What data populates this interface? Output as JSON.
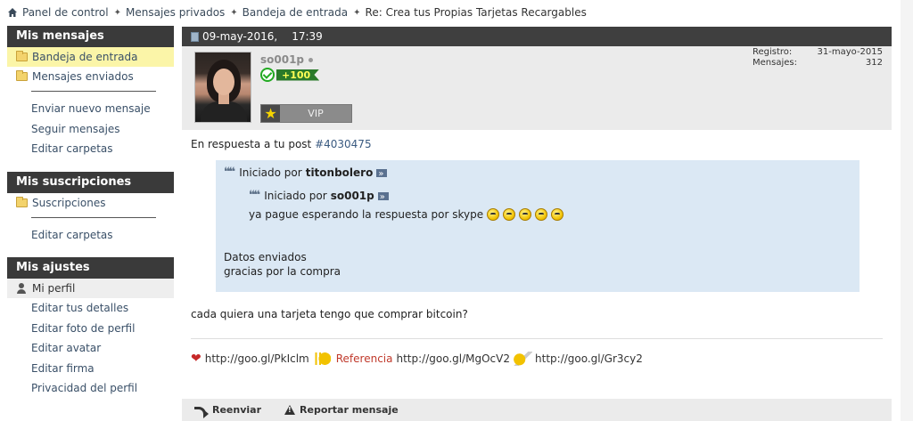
{
  "breadcrumb": {
    "items": [
      "Panel de control",
      "Mensajes privados",
      "Bandeja de entrada"
    ],
    "current": "Re: Crea tus Propias Tarjetas Recargables"
  },
  "sidebar": {
    "messages": {
      "title": "Mis mensajes",
      "folders": [
        "Bandeja de entrada",
        "Mensajes enviados"
      ],
      "links": [
        "Enviar nuevo mensaje",
        "Seguir mensajes",
        "Editar carpetas"
      ]
    },
    "subscriptions": {
      "title": "Mis suscripciones",
      "folders": [
        "Suscripciones"
      ],
      "links": [
        "Editar carpetas"
      ]
    },
    "settings": {
      "title": "Mis ajustes",
      "profile": "Mi perfil",
      "links": [
        "Editar tus detalles",
        "Editar foto de perfil",
        "Editar avatar",
        "Editar firma",
        "Privacidad del perfil"
      ]
    }
  },
  "post": {
    "date": "09-may-2016,",
    "time": "17:39",
    "username": "so001p",
    "reputation": "+100",
    "rank": "VIP",
    "stats": {
      "registro_label": "Registro:",
      "registro_value": "31-mayo-2015",
      "mensajes_label": "Mensajes:",
      "mensajes_value": "312"
    },
    "reply_prefix": "En respuesta a tu post",
    "reply_link": "#4030475",
    "quote": {
      "started_by": "Iniciado por",
      "author": "titonbolero",
      "nested_started_by": "Iniciado por",
      "nested_author": "so001p",
      "nested_text": "ya pague esperando la respuesta por skype",
      "line1": "Datos enviados",
      "line2": "gracias por la compra"
    },
    "body": "cada quiera una tarjeta tengo que comprar bitcoin?",
    "signature": {
      "link1": "http://goo.gl/PkIclm",
      "ref_label": "Referencia",
      "link2": "http://goo.gl/MgOcV2",
      "link3": "http://goo.gl/Gr3cy2"
    },
    "actions": {
      "forward": "Reenviar",
      "report": "Reportar mensaje"
    }
  }
}
